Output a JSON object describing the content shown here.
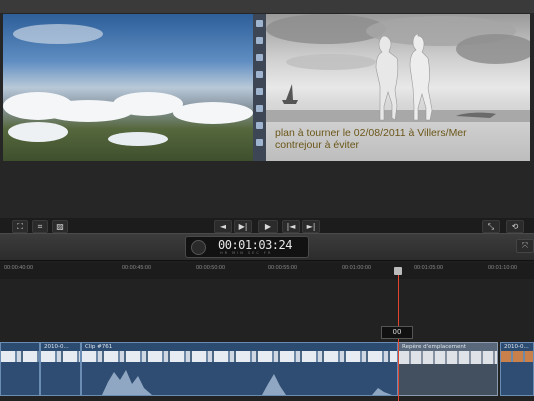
{
  "viewer": {
    "caption_line1": "plan à tourner le 02/08/2011 à Villers/Mer",
    "caption_line2": "contrejour à éviter"
  },
  "transport": {
    "left_controls": [
      "⛶",
      "⌗",
      "▨"
    ],
    "prev_label": "◄",
    "step_label": "▶|",
    "play_label": "▶",
    "skip_back_label": "|◄",
    "skip_fwd_label": "►|",
    "right_controls": [
      "⤡",
      "⟲"
    ]
  },
  "dashboard": {
    "timecode": "00:01:03:24",
    "labels": "HR MIN SEC FR"
  },
  "ruler": {
    "ticks": [
      "00:00:40:00",
      "00:00:45:00",
      "00:00:50:00",
      "00:00:55:00",
      "00:01:00:00",
      "00:01:05:00",
      "00:01:10:00"
    ]
  },
  "playhead": {
    "label": "00"
  },
  "clips": [
    {
      "title": ""
    },
    {
      "title": "2010-0..."
    },
    {
      "title": "Clip #761"
    },
    {
      "title": "Repère d'emplacement"
    },
    {
      "title": "2010-0..."
    }
  ]
}
